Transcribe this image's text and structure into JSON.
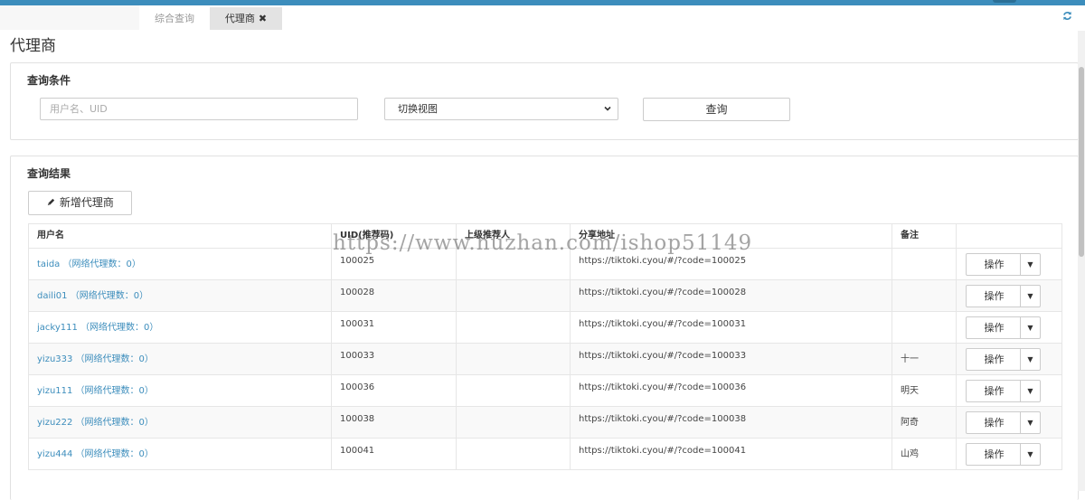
{
  "tabs": [
    {
      "label": "综合查询"
    },
    {
      "label": "代理商",
      "close": "✖"
    }
  ],
  "page_title": "代理商",
  "query_section": {
    "title": "查询条件",
    "search_placeholder": "用户名、UID",
    "view_select": "切换视图",
    "query_button": "查询"
  },
  "results_section": {
    "title": "查询结果",
    "add_button": "新增代理商",
    "columns": [
      "用户名",
      "UID(推荐码)",
      "上级推荐人",
      "分享地址",
      "备注",
      ""
    ],
    "rows": [
      {
        "username": "taida （网络代理数：0）",
        "uid": "100025",
        "referrer": "",
        "share_url": "https://tiktoki.cyou/#/?code=100025",
        "remark": "",
        "op": "操作"
      },
      {
        "username": "daili01 （网络代理数：0）",
        "uid": "100028",
        "referrer": "",
        "share_url": "https://tiktoki.cyou/#/?code=100028",
        "remark": "",
        "op": "操作"
      },
      {
        "username": "jacky111 （网络代理数：0）",
        "uid": "100031",
        "referrer": "",
        "share_url": "https://tiktoki.cyou/#/?code=100031",
        "remark": "",
        "op": "操作"
      },
      {
        "username": "yizu333 （网络代理数：0）",
        "uid": "100033",
        "referrer": "",
        "share_url": "https://tiktoki.cyou/#/?code=100033",
        "remark": "十一",
        "op": "操作"
      },
      {
        "username": "yizu111 （网络代理数：0）",
        "uid": "100036",
        "referrer": "",
        "share_url": "https://tiktoki.cyou/#/?code=100036",
        "remark": "明天",
        "op": "操作"
      },
      {
        "username": "yizu222 （网络代理数：0）",
        "uid": "100038",
        "referrer": "",
        "share_url": "https://tiktoki.cyou/#/?code=100038",
        "remark": "阿奇",
        "op": "操作"
      },
      {
        "username": "yizu444 （网络代理数：0）",
        "uid": "100041",
        "referrer": "",
        "share_url": "https://tiktoki.cyou/#/?code=100041",
        "remark": "山鸡",
        "op": "操作"
      }
    ]
  },
  "watermark": "https://www.huzhan.com/ishop51149",
  "colors": {
    "accent": "#3c8dbc",
    "border": "#e1e1e1"
  },
  "icons": {
    "refresh": "refresh-icon",
    "pencil": "pencil-icon",
    "caret": "caret-down-icon"
  }
}
